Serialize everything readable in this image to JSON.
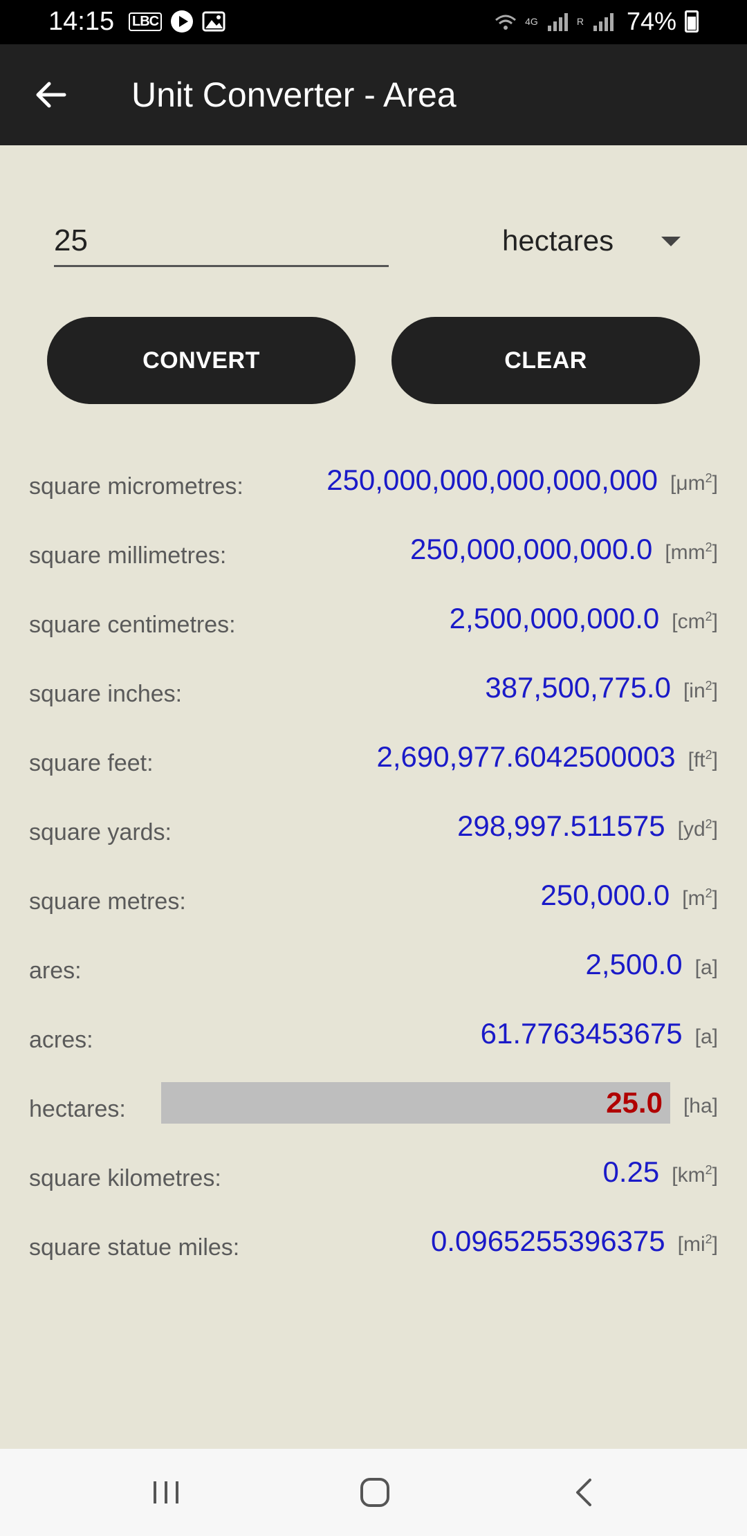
{
  "status": {
    "time": "14:15",
    "lbc": "LBC",
    "network": "4G",
    "roaming": "R",
    "battery": "74%",
    "battery_level": 0.74
  },
  "appbar": {
    "title": "Unit Converter - Area"
  },
  "input": {
    "value": "25",
    "unit": "hectares"
  },
  "buttons": {
    "convert": "CONVERT",
    "clear": "CLEAR"
  },
  "results": [
    {
      "label": "square micrometres:",
      "value": "250,000,000,000,000,000",
      "unit": "μm",
      "sup": "2"
    },
    {
      "label": "square millimetres:",
      "value": "250,000,000,000.0",
      "unit": "mm",
      "sup": "2"
    },
    {
      "label": "square centimetres:",
      "value": "2,500,000,000.0",
      "unit": "cm",
      "sup": "2"
    },
    {
      "label": "square inches:",
      "value": "387,500,775.0",
      "unit": "in",
      "sup": "2"
    },
    {
      "label": "square feet:",
      "value": "2,690,977.6042500003",
      "unit": "ft",
      "sup": "2"
    },
    {
      "label": "square yards:",
      "value": "298,997.511575",
      "unit": "yd",
      "sup": "2"
    },
    {
      "label": "square metres:",
      "value": "250,000.0",
      "unit": "m",
      "sup": "2"
    },
    {
      "label": "ares:",
      "value": "2,500.0",
      "unit": "a",
      "sup": ""
    },
    {
      "label": "acres:",
      "value": "61.7763453675",
      "unit": "a",
      "sup": ""
    },
    {
      "label": "hectares:",
      "value": "25.0",
      "unit": "ha",
      "sup": "",
      "highlight": true
    },
    {
      "label": "square kilometres:",
      "value": "0.25",
      "unit": "km",
      "sup": "2"
    },
    {
      "label": "square statue miles:",
      "value": "0.0965255396375",
      "unit": "mi",
      "sup": "2"
    }
  ],
  "colors": {
    "background": "#e6e4d6",
    "appbar": "#212121",
    "value_blue": "#1a1ac8",
    "highlight_red": "#b00000",
    "highlight_bg": "#bebebe"
  }
}
